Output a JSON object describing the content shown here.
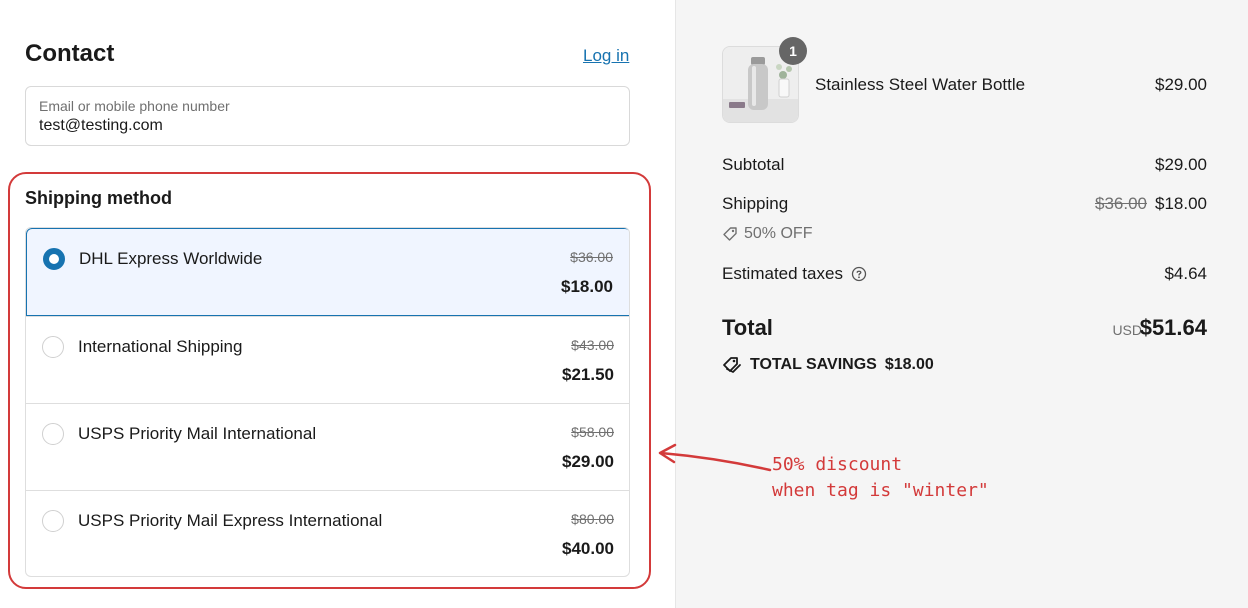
{
  "contact": {
    "title": "Contact",
    "login_label": "Log in",
    "email_label": "Email or mobile phone number",
    "email_value": "test@testing.com"
  },
  "shipping": {
    "title": "Shipping method",
    "options": [
      {
        "name": "DHL Express Worldwide",
        "old_price": "$36.00",
        "price": "$18.00",
        "selected": true
      },
      {
        "name": "International Shipping",
        "old_price": "$43.00",
        "price": "$21.50",
        "selected": false
      },
      {
        "name": "USPS Priority Mail International",
        "old_price": "$58.00",
        "price": "$29.00",
        "selected": false
      },
      {
        "name": "USPS Priority Mail Express International",
        "old_price": "$80.00",
        "price": "$40.00",
        "selected": false
      }
    ]
  },
  "annotation": {
    "line1": "50% discount",
    "line2": "when tag is \"winter\"",
    "color": "#d33a3a"
  },
  "cart": {
    "item": {
      "name": "Stainless Steel Water Bottle",
      "price": "$29.00",
      "quantity": "1",
      "icon": "water-bottle-image"
    },
    "subtotal_label": "Subtotal",
    "subtotal_value": "$29.00",
    "shipping_label": "Shipping",
    "shipping_old": "$36.00",
    "shipping_value": "$18.00",
    "discount_label": "50% OFF",
    "taxes_label": "Estimated taxes",
    "taxes_value": "$4.64",
    "total_label": "Total",
    "total_currency": "USD",
    "total_value": "$51.64",
    "savings_label": "TOTAL SAVINGS",
    "savings_value": "$18.00"
  },
  "colors": {
    "accent": "#1773b0",
    "selected_bg": "#f0f5ff",
    "summary_bg": "#f5f5f5"
  }
}
